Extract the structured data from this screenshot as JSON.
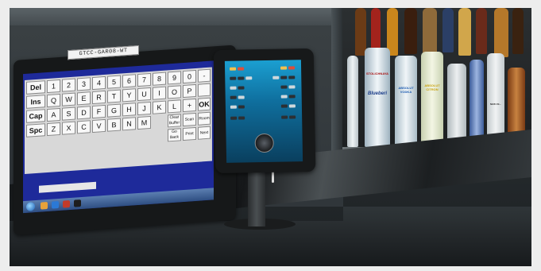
{
  "pos_terminal": {
    "asset_label": "GTCC-GAR08-WT",
    "keyboard": {
      "rows": [
        [
          "Del",
          "1",
          "2",
          "3",
          "4",
          "5",
          "6",
          "7",
          "8",
          "9",
          "0",
          "-"
        ],
        [
          "Ins",
          "Q",
          "W",
          "E",
          "R",
          "T",
          "Y",
          "U",
          "I",
          "O",
          "P",
          ""
        ],
        [
          "Cap",
          "A",
          "S",
          "D",
          "F",
          "G",
          "H",
          "J",
          "K",
          "L",
          "+",
          "OK"
        ],
        [
          "Spc",
          "Z",
          "X",
          "C",
          "V",
          "B",
          "N",
          "M",
          "",
          "",
          "",
          ""
        ]
      ],
      "special_keys": {
        "clear_buffer": "Clear Buffer",
        "scan": "Scan",
        "room": "Room",
        "go_back": "Go Back",
        "print": "Print",
        "next": "Next"
      }
    }
  },
  "bottle_labels": {
    "stolichnaya": "STOLICHNAYA",
    "stoli_blueberi": "Blueberi",
    "absolut_vodka": "ABSOLUT VODKA",
    "absolut_citron": "ABSOLUT CITRON",
    "new_zealand": "NEW ZE..."
  },
  "colors": {
    "screen_blue": "#1e2a9a",
    "tablet_screen": "#1b9fd1"
  }
}
